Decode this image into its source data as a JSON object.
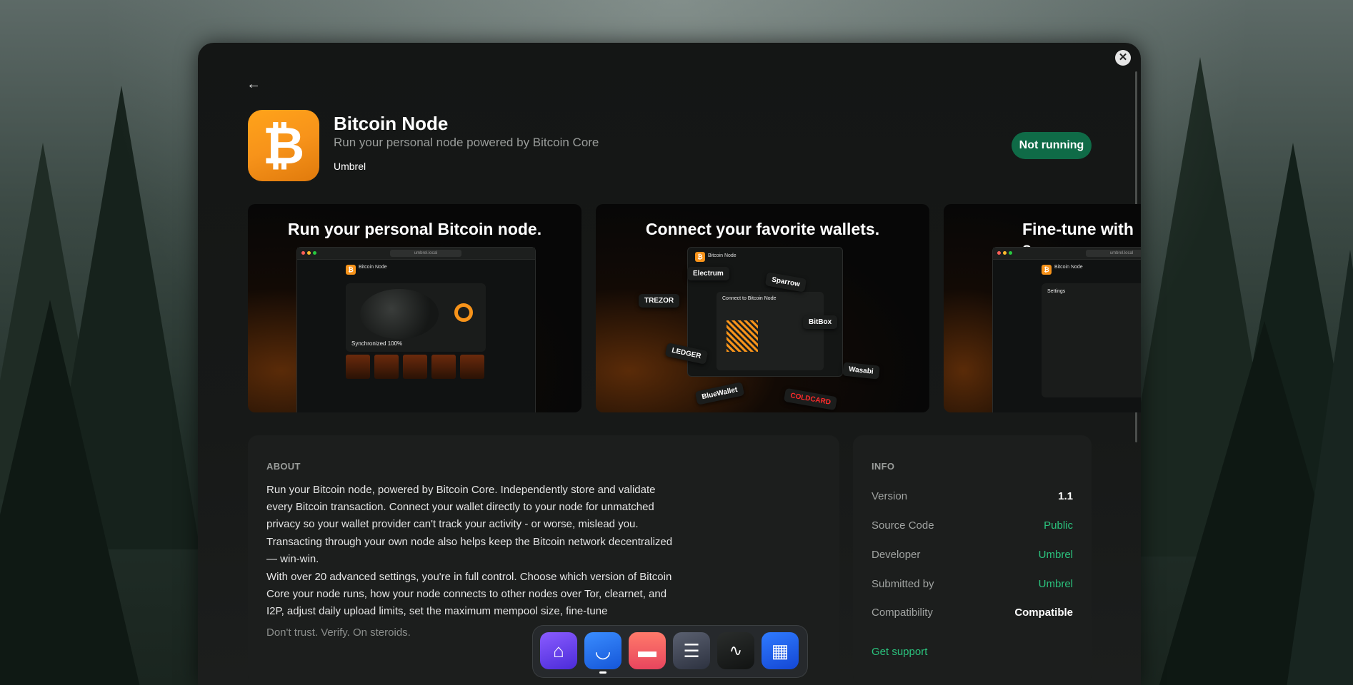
{
  "app": {
    "title": "Bitcoin Node",
    "tagline": "Run your personal node powered by Bitcoin Core",
    "developer": "Umbrel",
    "icon": "bitcoin-icon",
    "icon_glyph": "₿",
    "status_label": "Not running"
  },
  "gallery": {
    "shots": [
      {
        "caption": "Run your personal Bitcoin node.",
        "mock_url": "umbrel.local",
        "mock_app": "Bitcoin Node",
        "mock_sync": "Synchronized 100%"
      },
      {
        "caption": "Connect your favorite wallets.",
        "mock_app": "Bitcoin Node",
        "mock_dialog": "Connect to Bitcoin Node",
        "wallets": [
          "Electrum",
          "Sparrow",
          "TREZOR",
          "BitBox",
          "LEDGER",
          "Wasabi",
          "BlueWallet",
          "COLDCARD"
        ]
      },
      {
        "caption": "Fine-tune with s",
        "mock_url": "umbrel.local",
        "mock_app": "Bitcoin Node",
        "mock_settings": "Settings"
      }
    ]
  },
  "about": {
    "heading": "ABOUT",
    "paragraphs": [
      "Run your Bitcoin node, powered by Bitcoin Core. Independently store and validate every Bitcoin transaction. Connect your wallet directly to your node for unmatched privacy so your wallet provider can't track your activity - or worse, mislead you.",
      "Transacting through your own node also helps keep the Bitcoin network decentralized — win-win.",
      "With over 20 advanced settings, you're in full control. Choose which version of Bitcoin Core your node runs, how your node connects to other nodes over Tor, clearnet, and I2P, adjust daily upload limits, set the maximum mempool size, fine-tune",
      "Don't trust. Verify. On steroids."
    ]
  },
  "info": {
    "heading": "INFO",
    "rows": [
      {
        "label": "Version",
        "value": "1.1"
      },
      {
        "label": "Source Code",
        "value": "Public"
      },
      {
        "label": "Developer",
        "value": "Umbrel"
      },
      {
        "label": "Submitted by",
        "value": "Umbrel"
      },
      {
        "label": "Compatibility",
        "value": "Compatible"
      }
    ],
    "support_label": "Get support"
  },
  "dock": {
    "items": [
      {
        "icon": "home-icon"
      },
      {
        "icon": "app-store-icon"
      },
      {
        "icon": "files-icon"
      },
      {
        "icon": "settings-icon"
      },
      {
        "icon": "live-usage-icon"
      },
      {
        "icon": "widgets-icon"
      }
    ]
  },
  "colors": {
    "accent_green": "#2bc27d",
    "status_bg": "#0f6b47",
    "bitcoin_orange": "#f7931a"
  }
}
